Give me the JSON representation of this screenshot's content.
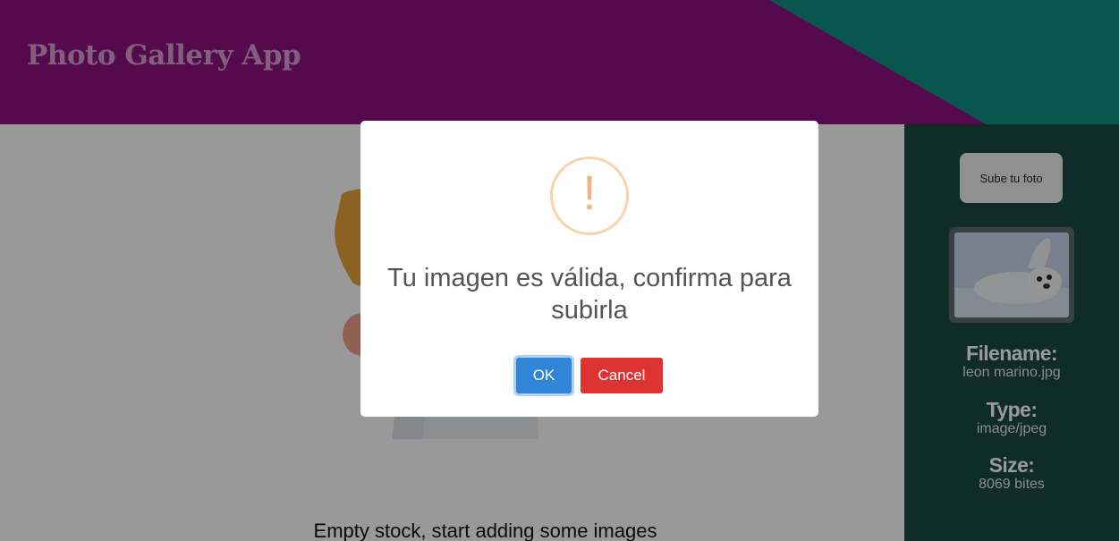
{
  "header": {
    "title": "Photo Gallery App"
  },
  "main": {
    "empty_message": "Empty stock, start adding some images"
  },
  "sidebar": {
    "upload_label": "Sube tu foto",
    "file": {
      "filename_label": "Filename:",
      "filename_value": "leon marino.jpg",
      "type_label": "Type:",
      "type_value": "image/jpeg",
      "size_label": "Size:",
      "size_value": "8069 bites"
    }
  },
  "dialog": {
    "icon": "warning-icon",
    "icon_symbol": "!",
    "message": "Tu imagen es válida, confirma para subirla",
    "ok_label": "OK",
    "cancel_label": "Cancel"
  },
  "colors": {
    "header_purple": "#8e1280",
    "header_teal": "#0e8f82",
    "sidebar": "#1a4a44",
    "ok_button": "#3085d6",
    "cancel_button": "#dd3333",
    "warning": "#f8bb86"
  }
}
